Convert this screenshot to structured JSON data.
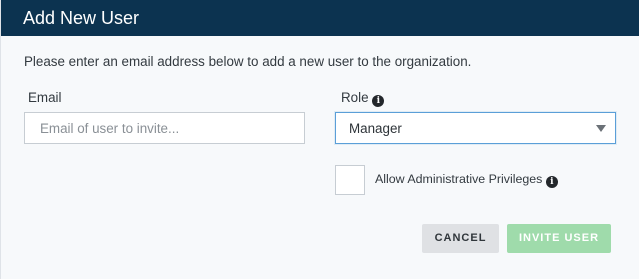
{
  "dialog": {
    "title": "Add New User",
    "intro": "Please enter an email address below to add a new user to the organization."
  },
  "email": {
    "label": "Email",
    "placeholder": "Email of user to invite...",
    "value": ""
  },
  "role": {
    "label": "Role",
    "selected": "Manager"
  },
  "admin": {
    "label": "Allow Administrative Privileges",
    "checked": false
  },
  "actions": {
    "cancel_label": "CANCEL",
    "invite_label": "INVITE USER"
  },
  "icons": {
    "info": "info-circle-icon",
    "caret": "caret-down-icon"
  },
  "colors": {
    "header_bg": "#0c3350",
    "invite_bg": "#9fdbab",
    "cancel_bg": "#dfe1e4",
    "select_border": "#5b9fd8"
  }
}
